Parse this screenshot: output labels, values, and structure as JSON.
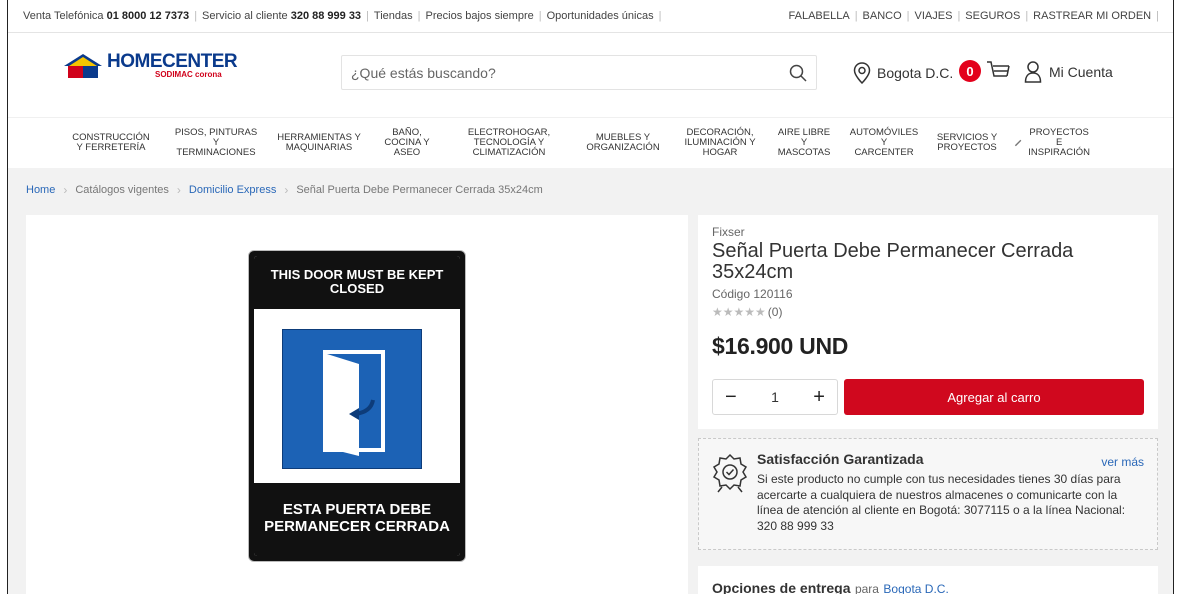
{
  "topbar": {
    "left": [
      {
        "label": "Venta Telefónica",
        "value": "01 8000 12 7373"
      },
      {
        "label": "Servicio al cliente",
        "value": "320 88 999 33"
      },
      {
        "label": "Tiendas"
      },
      {
        "label": "Precios bajos siempre"
      },
      {
        "label": "Oportunidades únicas"
      }
    ],
    "right": [
      "FALABELLA",
      "BANCO",
      "VIAJES",
      "SEGUROS",
      "RASTREAR MI ORDEN"
    ]
  },
  "header": {
    "logo_main": "HOMECENTER",
    "logo_sub": "SODIMAC corona",
    "search_placeholder": "¿Qué estás buscando?",
    "location": "Bogota D.C.",
    "cart_count": "0",
    "account": "Mi Cuenta"
  },
  "nav": [
    {
      "l1": "CONSTRUCCIÓN",
      "l2": "Y FERRETERÍA"
    },
    {
      "l1": "PISOS, PINTURAS Y",
      "l2": "TERMINACIONES"
    },
    {
      "l1": "HERRAMIENTAS Y",
      "l2": "MAQUINARIAS"
    },
    {
      "l1": "BAÑO,",
      "l2": "COCINA Y",
      "l3": "ASEO"
    },
    {
      "l1": "ELECTROHOGAR,",
      "l2": "TECNOLOGÍA Y",
      "l3": "CLIMATIZACIÓN"
    },
    {
      "l1": "MUEBLES Y",
      "l2": "ORGANIZACIÓN"
    },
    {
      "l1": "DECORACIÓN,",
      "l2": "ILUMINACIÓN Y",
      "l3": "HOGAR"
    },
    {
      "l1": "AIRE LIBRE Y",
      "l2": "MASCOTAS"
    },
    {
      "l1": "AUTOMÓVILES Y",
      "l2": "CARCENTER"
    },
    {
      "l1": "SERVICIOS Y",
      "l2": "PROYECTOS"
    },
    {
      "l1": "PROYECTOS E",
      "l2": "INSPIRACIÓN"
    }
  ],
  "breadcrumbs": [
    "Home",
    "Catálogos vigentes",
    "Domicilio Express",
    "Señal Puerta Debe Permanecer Cerrada 35x24cm"
  ],
  "product": {
    "brand": "Fixser",
    "title": "Señal Puerta Debe Permanecer Cerrada 35x24cm",
    "code": "Código 120116",
    "rating_stars": "★★★★★",
    "rating_count": "(0)",
    "price": "$16.900 UND",
    "quantity": "1",
    "qty_minus": "−",
    "qty_plus": "+",
    "add_to_cart": "Agregar al carro",
    "sign_top": "THIS DOOR MUST BE KEPT CLOSED",
    "sign_bottom": "ESTA PUERTA DEBE PERMANECER CERRADA"
  },
  "guarantee": {
    "title": "Satisfacción Garantizada",
    "more": "ver más",
    "text": "Si este producto no cumple con tus necesidades tienes 30 días para acercarte a cualquiera de nuestros almacenes o comunicarte con la línea de atención al cliente en Bogotá: 3077115 o a la línea Nacional: 320 88 999 33"
  },
  "delivery": {
    "title": "Opciones de entrega",
    "para": "para",
    "city": "Bogota D.C."
  },
  "colors": {
    "accent_red": "#d0081e",
    "brand_blue": "#0a3a8c",
    "link_blue": "#2a68b8"
  }
}
